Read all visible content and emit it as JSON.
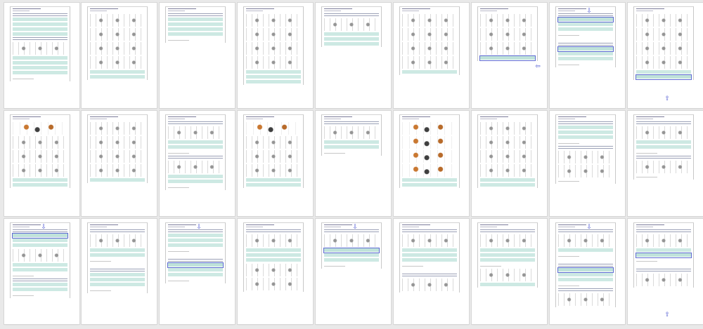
{
  "grid": {
    "columns": 9,
    "rows": 3,
    "pages": [
      {
        "blocks": [
          "q",
          "opt",
          "opt",
          "opt",
          "opt",
          "q",
          "img",
          "opt",
          "opt",
          "opt",
          "opt",
          "foot"
        ]
      },
      {
        "blocks": [
          "img",
          "img",
          "img",
          "img",
          "opt",
          "opt"
        ]
      },
      {
        "blocks": [
          "q",
          "opt",
          "opt",
          "opt",
          "opt",
          "foot"
        ]
      },
      {
        "blocks": [
          "img",
          "img",
          "img",
          "img",
          "opt",
          "opt",
          "opt"
        ]
      },
      {
        "blocks": [
          "q",
          "img",
          "opt",
          "opt",
          "opt"
        ]
      },
      {
        "blocks": [
          "img",
          "img",
          "img",
          "img",
          "opt"
        ]
      },
      {
        "blocks": [
          "img",
          "img",
          "img",
          "hl"
        ],
        "arrow": "left"
      },
      {
        "blocks": [
          "q",
          "hl",
          "opt",
          "opt",
          "foot",
          "gap",
          "q",
          "hl",
          "opt",
          "opt",
          "foot"
        ],
        "arrow": "down"
      },
      {
        "blocks": [
          "img",
          "img",
          "img",
          "img",
          "opt",
          "hl"
        ],
        "arrow": "up"
      },
      {
        "blocks": [
          "color",
          "img",
          "img",
          "img",
          "opt",
          "opt"
        ]
      },
      {
        "blocks": [
          "img",
          "img",
          "img",
          "img",
          "opt"
        ]
      },
      {
        "blocks": [
          "q",
          "img",
          "opt",
          "opt",
          "foot",
          "q",
          "img",
          "opt",
          "opt",
          "foot"
        ]
      },
      {
        "blocks": [
          "color",
          "img",
          "img",
          "img",
          "opt",
          "opt"
        ]
      },
      {
        "blocks": [
          "q",
          "img",
          "opt",
          "opt",
          "foot"
        ]
      },
      {
        "blocks": [
          "color",
          "color",
          "color",
          "color",
          "opt",
          "opt"
        ]
      },
      {
        "blocks": [
          "img",
          "img",
          "img",
          "img",
          "opt",
          "opt"
        ]
      },
      {
        "blocks": [
          "q",
          "opt",
          "opt",
          "opt",
          "foot",
          "q",
          "img",
          "img",
          "foot"
        ]
      },
      {
        "blocks": [
          "q",
          "img",
          "opt",
          "opt",
          "foot",
          "q",
          "img",
          "foot"
        ]
      },
      {
        "blocks": [
          "q",
          "hl",
          "opt",
          "opt",
          "img",
          "opt",
          "opt",
          "foot",
          "q",
          "opt",
          "opt",
          "foot"
        ],
        "arrow": "down"
      },
      {
        "blocks": [
          "q",
          "img",
          "opt",
          "opt",
          "foot",
          "gap",
          "q",
          "opt",
          "opt",
          "opt",
          "foot"
        ]
      },
      {
        "blocks": [
          "q",
          "opt",
          "opt",
          "opt",
          "foot",
          "gap",
          "q",
          "hl",
          "opt",
          "opt",
          "foot"
        ],
        "arrow": "down"
      },
      {
        "blocks": [
          "q",
          "img",
          "opt",
          "opt",
          "opt",
          "img",
          "img"
        ]
      },
      {
        "blocks": [
          "q",
          "img",
          "hl",
          "opt",
          "opt",
          "foot"
        ],
        "arrow": "down"
      },
      {
        "blocks": [
          "q",
          "img",
          "opt",
          "opt",
          "opt",
          "foot",
          "gap",
          "q",
          "img"
        ]
      },
      {
        "blocks": [
          "q",
          "img",
          "opt",
          "opt",
          "opt",
          "foot",
          "img",
          "opt"
        ]
      },
      {
        "blocks": [
          "q",
          "img",
          "opt",
          "foot",
          "gap",
          "q",
          "hl",
          "opt",
          "opt",
          "foot",
          "q",
          "img"
        ],
        "arrow": "down"
      },
      {
        "blocks": [
          "q",
          "img",
          "opt",
          "hl",
          "foot",
          "gap",
          "q",
          "img"
        ],
        "arrow": "up"
      }
    ]
  }
}
